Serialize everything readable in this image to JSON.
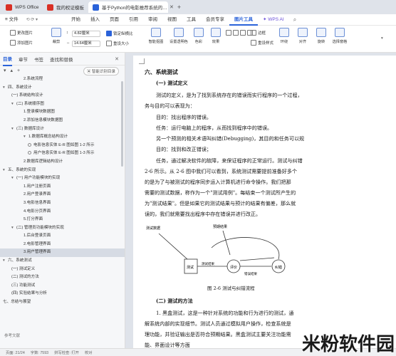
{
  "tabs": [
    {
      "label": "WPS Office",
      "color": "#d93025"
    },
    {
      "label": "我的权证模板",
      "color": "#d93025"
    },
    {
      "label": "基于Python的电影推荐系统的…",
      "color": "#2a62d9"
    }
  ],
  "menu": {
    "file": "≡ 文件",
    "items": [
      "开始",
      "插入",
      "页面",
      "引用",
      "审阅",
      "视图",
      "工具",
      "会员专享",
      "图片工具"
    ],
    "ai": "WPS AI"
  },
  "ribbon": {
    "change_pic": "更改图片",
    "add_pic": "添加图片",
    "crop": "裁剪",
    "height": "4.82厘米",
    "width": "14.64厘米",
    "lock_ratio": "锁定纵横比",
    "reset_size": "重设大小",
    "smart_matting": "智能抠图",
    "set_transparent": "设置透明色",
    "color": "色彩",
    "effects": "效果",
    "border": "边框",
    "reset_style": "重设样式",
    "wrap": "环绕",
    "align": "对齐",
    "rotate": "旋转",
    "select_pane": "选择窗格"
  },
  "sidebar": {
    "tabs": [
      "目录",
      "章节",
      "书签",
      "查找和替换"
    ],
    "smart_btn": "智能识别目录",
    "toc": [
      {
        "level": "l3",
        "text": "2.系统流程"
      },
      {
        "level": "l1",
        "text": "四、系统设计",
        "caret": "▾"
      },
      {
        "level": "l2",
        "text": "(一) 系统结构设计"
      },
      {
        "level": "l2",
        "text": "(二) 系统顺序图",
        "caret": "▾"
      },
      {
        "level": "l3",
        "text": "1.登录模块数据图"
      },
      {
        "level": "l3",
        "text": "2.添加信息模块数据图"
      },
      {
        "level": "l2",
        "text": "(三) 数据库设计",
        "caret": "▾"
      },
      {
        "level": "l3",
        "text": "1.数据库概念结构设计",
        "caret": "▾"
      },
      {
        "level": "l4",
        "text": "电影信息实体 E-R 图如图 1-2 所示",
        "dot": true
      },
      {
        "level": "l4",
        "text": "用户信息实体 E-R 图如图 1-3 所示",
        "dot": true
      },
      {
        "level": "l3",
        "text": "2.数据库逻辑结构设计"
      },
      {
        "level": "l1",
        "text": "五、系统的实现",
        "caret": "▾"
      },
      {
        "level": "l2",
        "text": "(一) 用户功能模块的实现",
        "caret": "▾"
      },
      {
        "level": "l3",
        "text": "1.用户注册页面"
      },
      {
        "level": "l3",
        "text": "2.用户登录界面"
      },
      {
        "level": "l3",
        "text": "3.电影信息界面"
      },
      {
        "level": "l3",
        "text": "4.电影分页界面"
      },
      {
        "level": "l3",
        "text": "5.打分界面"
      },
      {
        "level": "l2",
        "text": "(二) 管理员功能模块的实现",
        "caret": "▾"
      },
      {
        "level": "l3",
        "text": "1.后台登录页面"
      },
      {
        "level": "l3",
        "text": "2.电影管理界面"
      },
      {
        "level": "l3",
        "text": "3.用户管理界面",
        "sel": true
      },
      {
        "level": "l1",
        "text": "六、系统测试",
        "caret": "▾"
      },
      {
        "level": "l2",
        "text": "(一) 测试定义"
      },
      {
        "level": "l2",
        "text": "(二) 测试的方法"
      },
      {
        "level": "l2",
        "text": "(三) 功能测试"
      },
      {
        "level": "l2",
        "text": "(四) 实验结果与分析"
      },
      {
        "level": "l1",
        "text": "七、总结与展望"
      }
    ],
    "footer": "参考文献"
  },
  "doc": {
    "h1": "六、系统测试",
    "h2a": "(一) 测试定义",
    "p": [
      "测试的定义，是为了找到系统存在的错误而实行程序的一个过程，",
      "务与目的可以表现为：",
      "目的：找出程序的错误。",
      "任务：运行电脑上的程序，从而找到程序中的错误。",
      "另一个预测的相关术语叫纠错(Debugging)，其目的和任务可以规",
      "目的：找到和改正错误；",
      "任务，通过解决软件的故障，来保证程序的正常运行。测试与纠错",
      "2-6 所示。从 2-6 图中我们可以看到，系统测试需要提前准备好多个",
      "的是为了与被测试的程序同步运入计算机进行命令操作。我们把那",
      "需要的测试数据，称作为一个\"测试用例\"。每结束一个测试所产生的",
      "为\"测试结果\"。但是如果它的测试结果与预计的结果有偏差，那么就",
      "误的，我们就需要找出程序中存在错误并进行改正。"
    ],
    "fig": {
      "n1": "测试",
      "n2": "评价",
      "n3": "纠错",
      "l1": "测试数据",
      "l2": "预期结果",
      "l3": "测试结果",
      "l4": "错误结果",
      "caption": "图 2-6 测试与纠错流程"
    },
    "h2b": "(二) 测试的方法",
    "p2": [
      "1.  黑盒测试，这是一种针对系统的功能和行为进行的测试，通",
      "解系统内部的实现细节。测试人员通过模拟用户操作，检查系统是",
      "理功能，并验证输出是否符合预期结果。黑盒测试主要关注功能需",
      "能、界面设计等方面"
    ]
  },
  "status": [
    "页面: 21/24",
    "字数: 7593",
    "拼写检查: 打开",
    "校对"
  ],
  "watermark": "米粉软件园"
}
